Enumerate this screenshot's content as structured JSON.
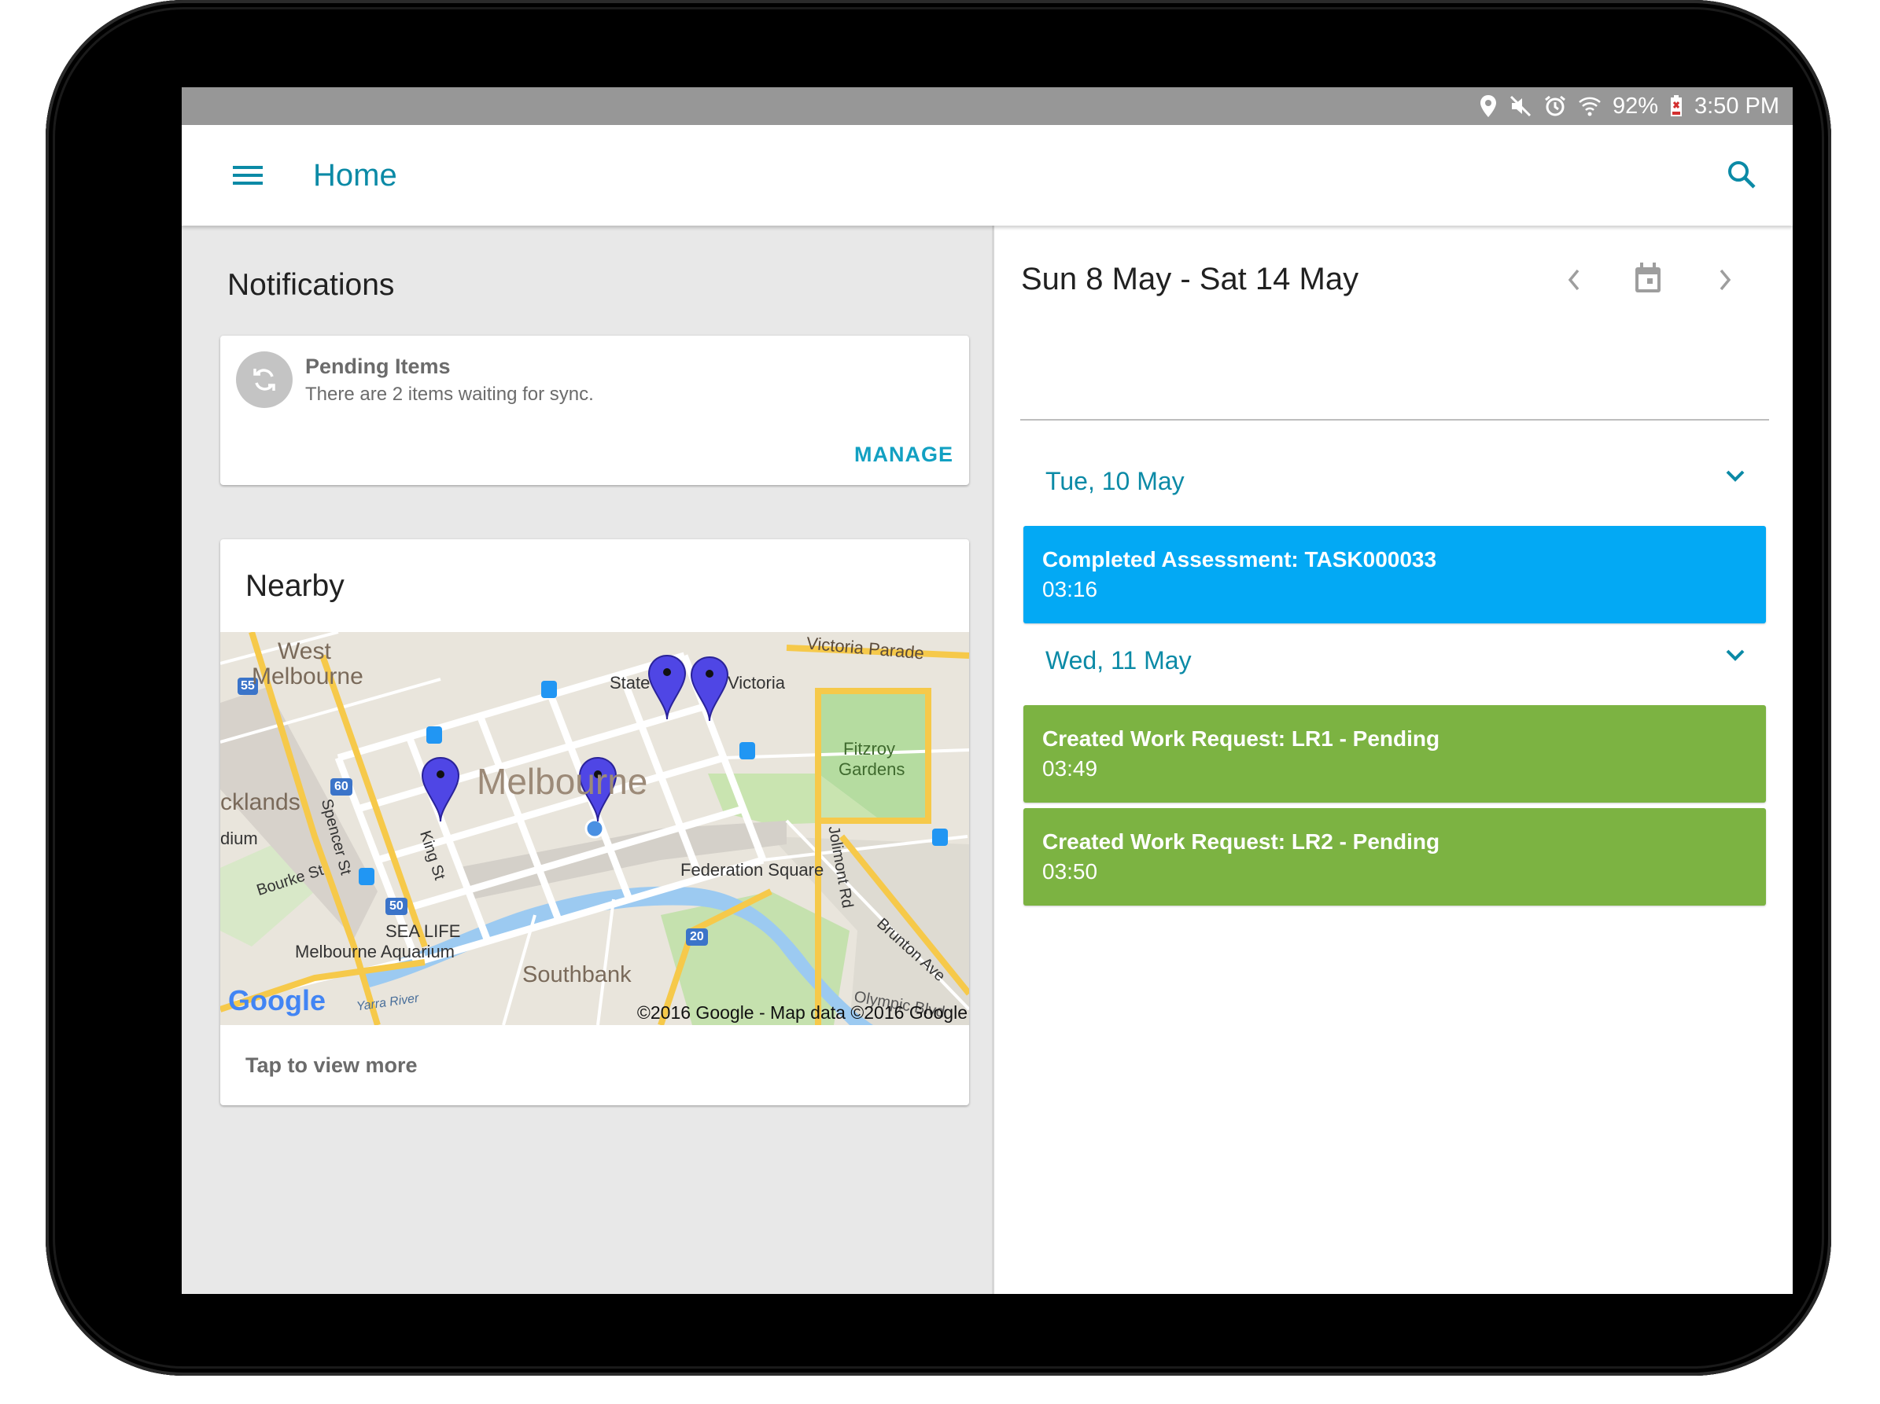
{
  "status_bar": {
    "battery": "92%",
    "time": "3:50 PM",
    "icons": [
      "location-icon",
      "mute-icon",
      "alarm-icon",
      "wifi-icon",
      "battery-icon"
    ]
  },
  "app_bar": {
    "title": "Home",
    "menu_icon": "hamburger-menu-icon",
    "search_icon": "search-icon",
    "accent_color": "#0B8AA6"
  },
  "notifications": {
    "title": "Notifications",
    "pending": {
      "title": "Pending Items",
      "message": "There are 2 items waiting for sync.",
      "action": "MANAGE",
      "icon": "sync-icon"
    }
  },
  "nearby": {
    "title": "Nearby",
    "map": {
      "labels": {
        "west_melbourne_1": "West",
        "west_melbourne_2": "Melbourne",
        "victoria_parade": "Victoria Parade",
        "state": "State",
        "victoria": "Victoria",
        "melbourne": "Melbourne",
        "fitzroy_1": "Fitzroy",
        "fitzroy_2": "Gardens",
        "docklands": "cklands",
        "stadium": "dium",
        "spencer_st": "Spencer St",
        "king_st": "King St",
        "bourke_st": "Bourke St",
        "federation_square": "Federation Square",
        "jolimont_rd": "Jolimont Rd",
        "brunton_ave": "Brunton Ave",
        "sea_life_1": "SEA LIFE",
        "sea_life_2": "Melbourne Aquarium",
        "southbank": "Southbank",
        "yarra_river": "Yarra River",
        "olympic": "Olympic Blvd",
        "route_55": "55",
        "route_60": "60",
        "route_50": "50",
        "route_20": "20"
      },
      "google_logo": "Google",
      "copyright": "©2016 Google - Map data ©2016 Google"
    },
    "footer": "Tap to view more"
  },
  "schedule": {
    "range": "Sun 8 May  -  Sat 14 May",
    "prev_icon": "chevron-left-icon",
    "calendar_icon": "calendar-icon",
    "next_icon": "chevron-right-icon",
    "days": [
      {
        "label": "Tue, 10 May",
        "events": [
          {
            "title": "Completed Assessment: TASK000033",
            "time": "03:16",
            "color": "#03A9F4"
          }
        ]
      },
      {
        "label": "Wed, 11 May",
        "events": [
          {
            "title": "Created Work Request: LR1 - Pending",
            "time": "03:49",
            "color": "#7CB342"
          },
          {
            "title": "Created Work Request: LR2 - Pending",
            "time": "03:50",
            "color": "#7CB342"
          }
        ]
      }
    ]
  }
}
